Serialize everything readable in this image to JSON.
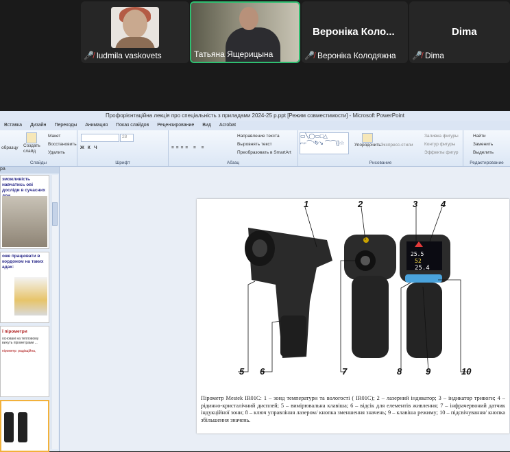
{
  "participants": [
    {
      "name": "ludmila vaskovets",
      "muted": true
    },
    {
      "name": "Татьяна Ящерицына",
      "muted": false
    },
    {
      "display": "Вероніка Коло...",
      "name": "Вероніка Колодяжна",
      "muted": true
    },
    {
      "display": "Dima",
      "name": "Dima",
      "muted": true
    }
  ],
  "ppt": {
    "window_title": "Профорієнтаційна лекція про  спеціальність з приладами 2024-25 р.ppt [Режим совместимости] - Microsoft PowerPoint",
    "tabs": [
      "Вставка",
      "Дизайн",
      "Переходы",
      "Анимация",
      "Показ слайдов",
      "Рецензирование",
      "Вид",
      "Acrobat"
    ],
    "ribbon": {
      "slides_group": "Слайды",
      "font_group": "Шрифт",
      "para_group": "Абзац",
      "draw_group": "Рисование",
      "edit_group": "Редактирование",
      "create_slide": "Создать слайд",
      "layout": "Макет",
      "restore": "Восстановить",
      "delete": "Удалить",
      "obrazcu": "образцу",
      "font_size": "28",
      "text_dir": "Направление текста",
      "align_text": "Выровнять текст",
      "smartart": "Преобразовать в SmartArt",
      "arrange": "Упорядочить",
      "quick_styles": "Экспресс-стили",
      "fill": "Заливка фигуры",
      "outline": "Контур фигуры",
      "effects": "Эффекты фигур",
      "find": "Найти",
      "replace": "Заменить",
      "select": "Выделить"
    },
    "thumb_texts": {
      "t1": "зможливість навчатись ові досліди в сучасних дри",
      "t2": "оже працювати в кордоном на таких адах:",
      "t3a": "ї пірометри",
      "t3b": "основані на тепловому вихуть пірометрами ...",
      "t3c": "пірометр: радіаційна,"
    },
    "slide": {
      "labels": [
        "1",
        "2",
        "3",
        "4",
        "5",
        "6",
        "7",
        "8",
        "9",
        "10"
      ],
      "caption": "Пірометр Mestek IR01C: 1 – зонд температури та вологості ( IR01C); 2 – лазерний індикатор; 3 – індикатор тривоги; 4 – рідинно-кристалічний дисплей; 5 – вимірювальна клавіша; 6  – відсік для елементів живлення; 7 – інфрачервоний датчик індукційної зони; 8 – ключ управління лазером/ кнопка зменшення значень; 9 – клавіша режиму; 10 – підсвічування/ кнопка збільшення значень.",
      "display_values": [
        "25.5",
        "52",
        "25.4"
      ]
    }
  }
}
